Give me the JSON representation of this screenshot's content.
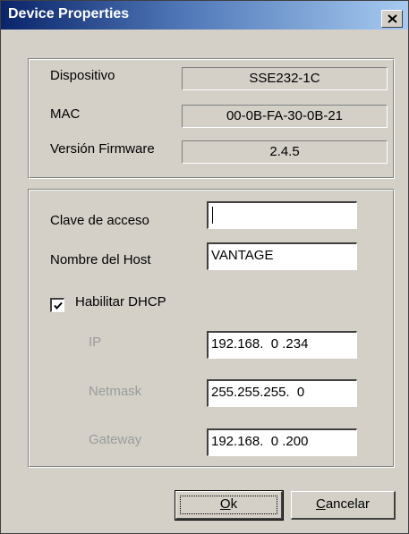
{
  "window": {
    "title": "Device Properties"
  },
  "info": {
    "device_label": "Dispositivo",
    "device_value": "SSE232-1C",
    "mac_label": "MAC",
    "mac_value": "00-0B-FA-30-0B-21",
    "firmware_label": "Versión Firmware",
    "firmware_value": "2.4.5"
  },
  "settings": {
    "password_label": "Clave de acceso",
    "password_value": "",
    "host_label": "Nombre del Host",
    "host_value": "VANTAGE",
    "dhcp_label": "Habilitar DHCP",
    "dhcp_checked": true,
    "ip_label": "IP",
    "ip_value": "192.168.  0 .234",
    "netmask_label": "Netmask",
    "netmask_value": "255.255.255.  0",
    "gateway_label": "Gateway",
    "gateway_value": "192.168.  0 .200"
  },
  "buttons": {
    "ok_mnemonic": "O",
    "ok_rest": "k",
    "cancel_mnemonic": "C",
    "cancel_rest": "ancelar"
  }
}
